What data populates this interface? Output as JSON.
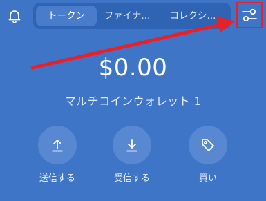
{
  "header": {
    "bell_icon": "bell-icon",
    "filter_icon": "sliders-icon",
    "highlight_color": "#e8202a"
  },
  "tabs": [
    {
      "label": "トークン",
      "active": true
    },
    {
      "label": "ファイナ...",
      "active": false
    },
    {
      "label": "コレクシ...",
      "active": false
    }
  ],
  "wallet": {
    "balance": "$0.00",
    "name": "マルチコインウォレット 1"
  },
  "actions": [
    {
      "label": "送信する",
      "icon": "upload-arrow-icon"
    },
    {
      "label": "受信する",
      "icon": "download-arrow-icon"
    },
    {
      "label": "買い",
      "icon": "price-tag-icon"
    }
  ],
  "colors": {
    "background": "#3f75c7",
    "tabbar": "#2f63b3",
    "active_tab": "#4a7ccc",
    "action_circle": "#5888d2",
    "annotation_arrow": "#e8202a"
  }
}
